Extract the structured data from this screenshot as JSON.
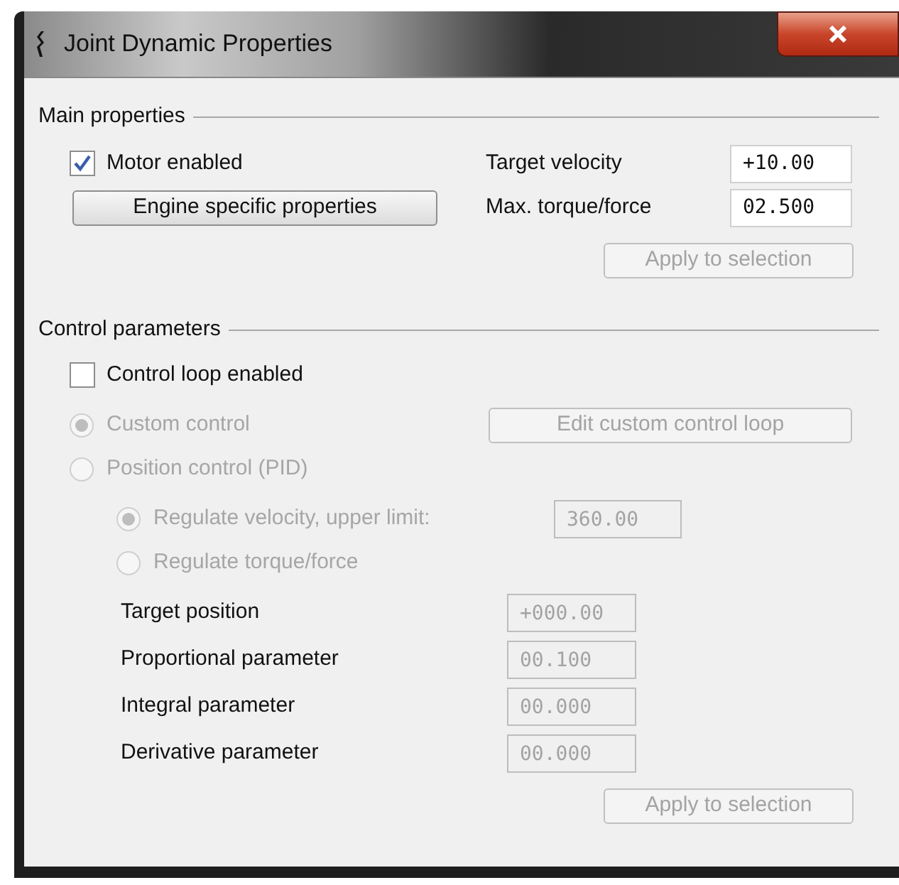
{
  "window": {
    "title": "Joint Dynamic Properties"
  },
  "main_properties": {
    "title": "Main properties",
    "motor_enabled": {
      "label": "Motor enabled",
      "checked": true
    },
    "engine_button": {
      "label": "Engine specific properties",
      "disabled": false
    },
    "fields": [
      {
        "label": "Target velocity",
        "value": "+10.00",
        "disabled": false
      },
      {
        "label": "Max. torque/force",
        "value": "02.500",
        "disabled": false
      }
    ],
    "apply_button": {
      "label": "Apply to selection",
      "disabled": true
    }
  },
  "control_parameters": {
    "title": "Control parameters",
    "control_loop": {
      "label": "Control loop enabled",
      "checked": false
    },
    "modes": [
      {
        "label": "Custom control",
        "selected": true,
        "disabled": true
      },
      {
        "label": "Position control (PID)",
        "selected": false,
        "disabled": true
      }
    ],
    "edit_button": {
      "label": "Edit custom control loop",
      "disabled": true
    },
    "regulation": [
      {
        "label": "Regulate velocity, upper limit:",
        "selected": true,
        "disabled": true,
        "value": "360.00"
      },
      {
        "label": "Regulate torque/force",
        "selected": false,
        "disabled": true
      }
    ],
    "pid_fields": [
      {
        "label": "Target position",
        "value": "+000.00",
        "disabled": true
      },
      {
        "label": "Proportional parameter",
        "value": "00.100",
        "disabled": true
      },
      {
        "label": "Integral parameter",
        "value": "00.000",
        "disabled": true
      },
      {
        "label": "Derivative parameter",
        "value": "00.000",
        "disabled": true
      }
    ],
    "apply_button": {
      "label": "Apply to selection",
      "disabled": true
    }
  }
}
